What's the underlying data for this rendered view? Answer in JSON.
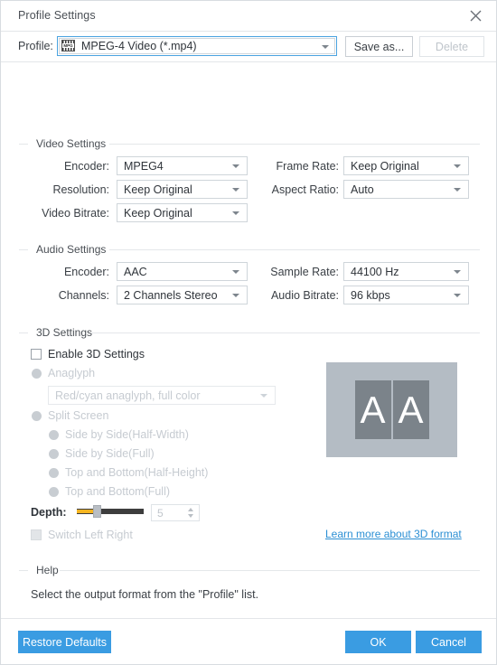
{
  "window": {
    "title": "Profile Settings",
    "close_icon": "close-icon"
  },
  "profile": {
    "label": "Profile:",
    "value": "MPEG-4 Video (*.mp4)",
    "icon_label": "MPG",
    "save_as_label": "Save as...",
    "delete_label": "Delete"
  },
  "video_settings": {
    "caption": "Video Settings",
    "encoder_label": "Encoder:",
    "encoder_value": "MPEG4",
    "resolution_label": "Resolution:",
    "resolution_value": "Keep Original",
    "video_bitrate_label": "Video Bitrate:",
    "video_bitrate_value": "Keep Original",
    "frame_rate_label": "Frame Rate:",
    "frame_rate_value": "Keep Original",
    "aspect_ratio_label": "Aspect Ratio:",
    "aspect_ratio_value": "Auto"
  },
  "audio_settings": {
    "caption": "Audio Settings",
    "encoder_label": "Encoder:",
    "encoder_value": "AAC",
    "channels_label": "Channels:",
    "channels_value": "2 Channels Stereo",
    "sample_rate_label": "Sample Rate:",
    "sample_rate_value": "44100 Hz",
    "audio_bitrate_label": "Audio Bitrate:",
    "audio_bitrate_value": "96 kbps"
  },
  "three_d_settings": {
    "caption": "3D Settings",
    "enable_label": "Enable 3D Settings",
    "anaglyph_label": "Anaglyph",
    "anaglyph_value": "Red/cyan anaglyph, full color",
    "split_screen_label": "Split Screen",
    "split_options": [
      "Side by Side(Half-Width)",
      "Side by Side(Full)",
      "Top and Bottom(Half-Height)",
      "Top and Bottom(Full)"
    ],
    "depth_label": "Depth:",
    "depth_value": "5",
    "switch_left_right_label": "Switch Left Right",
    "learn_more_label": "Learn more about 3D format",
    "preview_glyph_left": "A",
    "preview_glyph_right": "A"
  },
  "help": {
    "caption": "Help",
    "text": "Select the output format from the \"Profile\" list."
  },
  "footer": {
    "restore_defaults_label": "Restore Defaults",
    "ok_label": "OK",
    "cancel_label": "Cancel"
  },
  "colors": {
    "accent": "#3a9ce2",
    "link": "#2b8fd4",
    "slider_fill": "#f5b521"
  }
}
